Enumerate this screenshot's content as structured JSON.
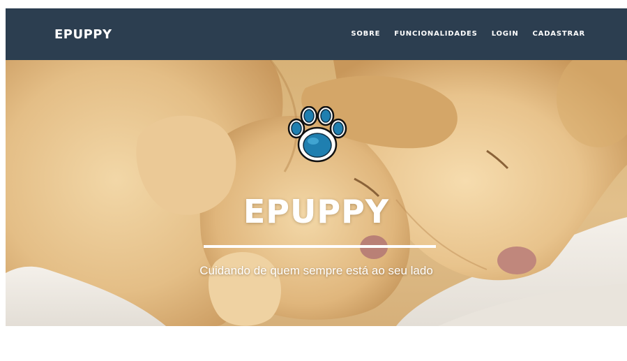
{
  "navbar": {
    "brand": "EPUPPY",
    "links": [
      {
        "label": "SOBRE"
      },
      {
        "label": "FUNCIONALIDADES"
      },
      {
        "label": "LOGIN"
      },
      {
        "label": "CADASTRAR"
      }
    ]
  },
  "hero": {
    "title": "EPUPPY",
    "subtitle": "Cuidando de quem sempre está ao seu lado",
    "logo_icon": "paw-icon"
  },
  "colors": {
    "navbar_bg": "#2c3e50",
    "nav_text": "#ffffff",
    "paw_blue": "#1f7fb0",
    "hero_text": "#ffffff"
  }
}
